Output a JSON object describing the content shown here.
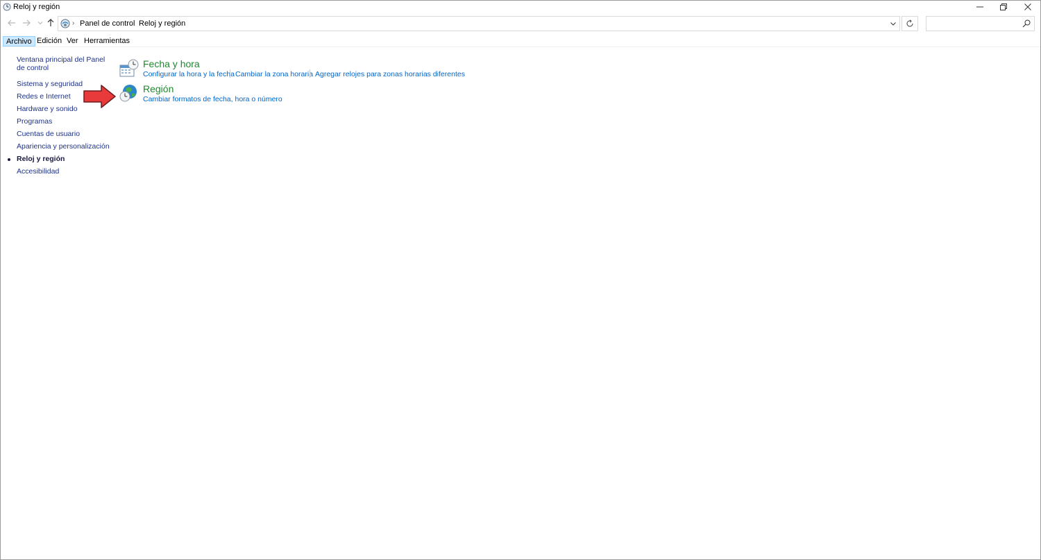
{
  "window": {
    "title": "Reloj y región"
  },
  "address": {
    "crumbs": [
      "Panel de control",
      "Reloj y región"
    ]
  },
  "search": {
    "placeholder": ""
  },
  "menubar": {
    "items": [
      "Archivo",
      "Edición",
      "Ver",
      "Herramientas"
    ]
  },
  "sidebar": {
    "home": "Ventana principal del Panel de control",
    "items": [
      "Sistema y seguridad",
      "Redes e Internet",
      "Hardware y sonido",
      "Programas",
      "Cuentas de usuario",
      "Apariencia y personalización",
      "Reloj y región",
      "Accesibilidad"
    ]
  },
  "sections": [
    {
      "title": "Fecha y hora",
      "icon": "calendar-clock-icon",
      "tasks": [
        "Configurar la hora y la fecha",
        "Cambiar la zona horaria",
        "Agregar relojes para zonas horarias diferentes"
      ]
    },
    {
      "title": "Región",
      "icon": "globe-clock-icon",
      "tasks": [
        "Cambiar formatos de fecha, hora o número"
      ]
    }
  ],
  "colors": {
    "section_title": "#1e8a2e",
    "task_link": "#0066cc",
    "sidebar_link": "#1e3287",
    "menu_active_bg": "#cce8ff",
    "annotation_arrow": "#e8393b"
  }
}
